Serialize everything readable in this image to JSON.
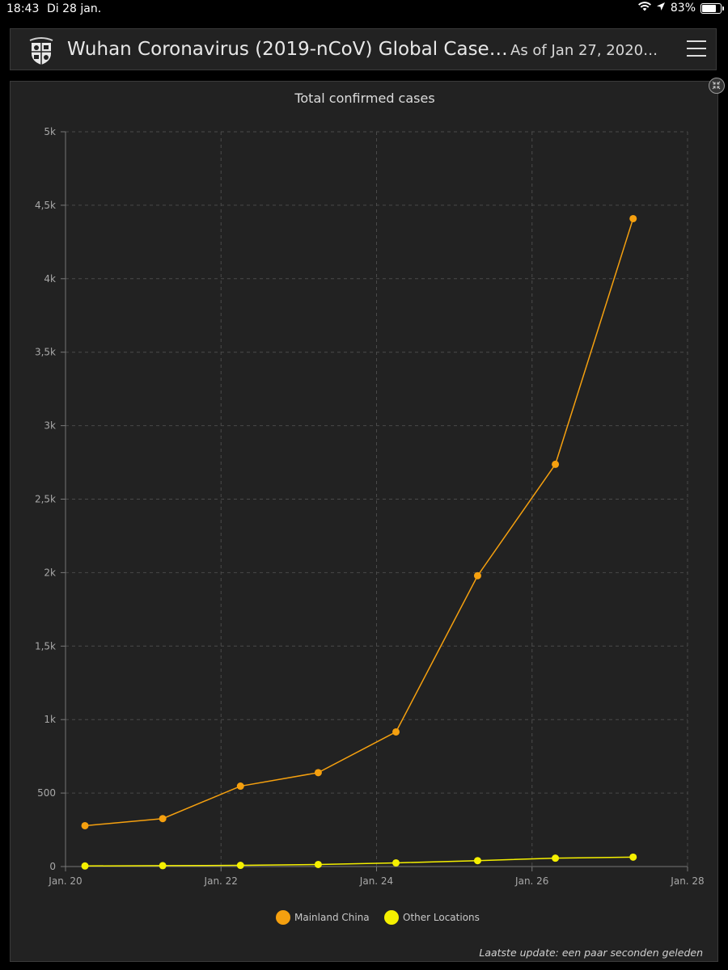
{
  "status_bar": {
    "time": "18:43",
    "date": "Di 28 jan.",
    "battery": "83%",
    "battery_level": 0.83
  },
  "header": {
    "title": "Wuhan Coronavirus (2019-nCoV) Global Case…",
    "as_of": "As of Jan 27, 2020…",
    "menu_icon": "hamburger-menu-icon",
    "logo_icon": "university-shield-logo"
  },
  "panel": {
    "collapse_icon": "collapse-arrows-icon",
    "footer_note": "Laatste update: een paar seconden geleden"
  },
  "chart_data": {
    "type": "line",
    "title": "Total confirmed cases",
    "xlabel": "",
    "ylabel": "",
    "x_range": [
      20,
      28
    ],
    "ylim": [
      0,
      5000
    ],
    "x_ticks": [
      {
        "value": 20,
        "label": "Jan. 20"
      },
      {
        "value": 22,
        "label": "Jan. 22"
      },
      {
        "value": 24,
        "label": "Jan. 24"
      },
      {
        "value": 26,
        "label": "Jan. 26"
      },
      {
        "value": 28,
        "label": "Jan. 28"
      }
    ],
    "y_ticks": [
      {
        "value": 0,
        "label": "0"
      },
      {
        "value": 500,
        "label": "500"
      },
      {
        "value": 1000,
        "label": "1k"
      },
      {
        "value": 1500,
        "label": "1,5k"
      },
      {
        "value": 2000,
        "label": "2k"
      },
      {
        "value": 2500,
        "label": "2,5k"
      },
      {
        "value": 3000,
        "label": "3k"
      },
      {
        "value": 3500,
        "label": "3,5k"
      },
      {
        "value": 4000,
        "label": "4k"
      },
      {
        "value": 4500,
        "label": "4,5k"
      },
      {
        "value": 5000,
        "label": "5k"
      }
    ],
    "grid": true,
    "legend_position": "bottom-center",
    "series": [
      {
        "name": "Mainland China",
        "color": "#f5a00f",
        "points": [
          {
            "x": 20.25,
            "y": 278
          },
          {
            "x": 21.25,
            "y": 326
          },
          {
            "x": 22.25,
            "y": 547
          },
          {
            "x": 23.25,
            "y": 639
          },
          {
            "x": 24.25,
            "y": 916
          },
          {
            "x": 25.3,
            "y": 1979
          },
          {
            "x": 26.3,
            "y": 2737
          },
          {
            "x": 27.3,
            "y": 4409
          }
        ]
      },
      {
        "name": "Other Locations",
        "color": "#f5f000",
        "points": [
          {
            "x": 20.25,
            "y": 4
          },
          {
            "x": 21.25,
            "y": 6
          },
          {
            "x": 22.25,
            "y": 8
          },
          {
            "x": 23.25,
            "y": 14
          },
          {
            "x": 24.25,
            "y": 25
          },
          {
            "x": 25.3,
            "y": 40
          },
          {
            "x": 26.3,
            "y": 57
          },
          {
            "x": 27.3,
            "y": 64
          }
        ]
      }
    ]
  }
}
